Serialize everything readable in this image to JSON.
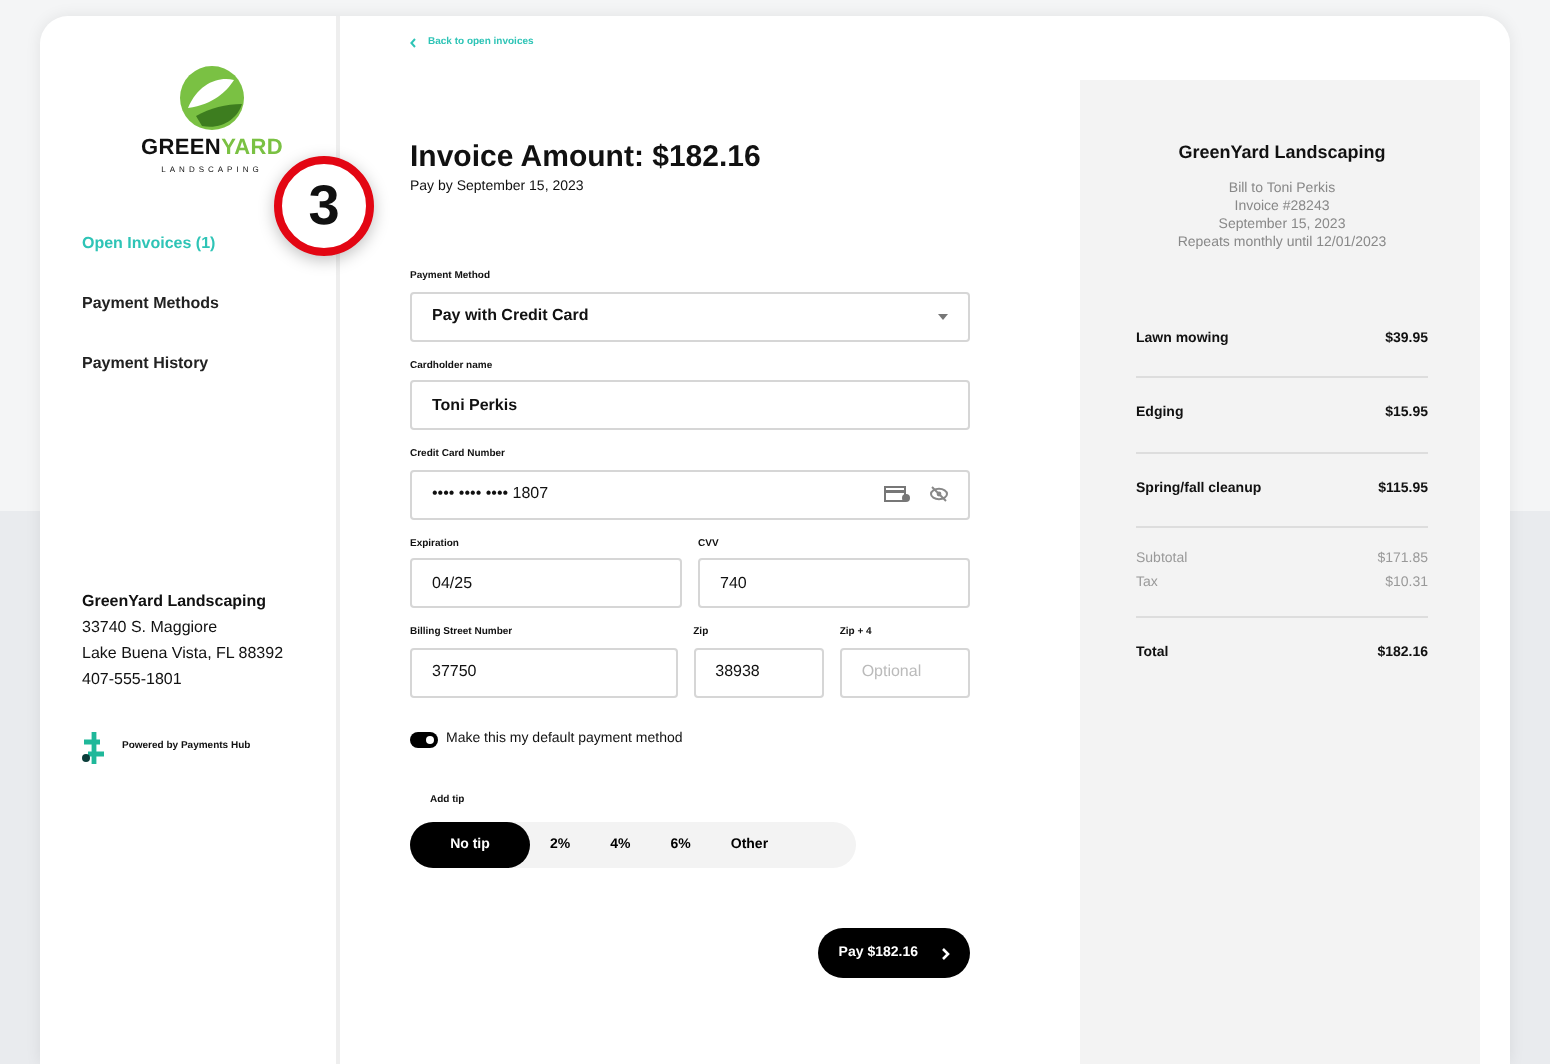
{
  "brand": {
    "name_dark": "GREEN",
    "name_accent": "YARD",
    "tagline": "LANDSCAPING"
  },
  "sidebar": {
    "items": [
      {
        "label": "Open Invoices (1)",
        "selected": true
      },
      {
        "label": "Payment Methods",
        "selected": false
      },
      {
        "label": "Payment History",
        "selected": false
      }
    ],
    "company": {
      "name": "GreenYard Landscaping",
      "lines": [
        "33740 S. Maggiore",
        "Lake Buena Vista, FL 88392",
        "407-555-1801"
      ]
    },
    "powered_by": "Powered by Payments Hub"
  },
  "step_badge": "3",
  "back_link": "Back to open invoices",
  "title": "Invoice Amount: $182.16",
  "subtitle": "Pay by September 15, 2023",
  "form": {
    "rows": [
      [
        {
          "kind": "select",
          "label": "Payment Method",
          "value": "Pay with Credit Card"
        }
      ],
      [
        {
          "kind": "text",
          "label": "Cardholder name",
          "value": "Toni Perkis"
        }
      ],
      [
        {
          "kind": "card",
          "label": "Credit Card Number",
          "value": "•••• •••• •••• 1807"
        }
      ],
      [
        {
          "kind": "text",
          "label": "Expiration",
          "value": "04/25"
        },
        {
          "kind": "text",
          "label": "CVV",
          "value": "740"
        }
      ],
      [
        {
          "kind": "text",
          "label": "Billing Street Number",
          "value": "37750"
        },
        {
          "kind": "text",
          "label": "Zip",
          "value": "38938"
        },
        {
          "kind": "text",
          "label": "Zip + 4",
          "placeholder": "Optional"
        }
      ]
    ]
  },
  "default_toggle": {
    "label": "Make this my default payment method",
    "on": true
  },
  "tip": {
    "label": "Add tip",
    "options": [
      {
        "label": "No tip",
        "selected": true
      },
      {
        "label": "2%",
        "selected": false
      },
      {
        "label": "4%",
        "selected": false
      },
      {
        "label": "6%",
        "selected": false
      },
      {
        "label": "Other",
        "selected": false
      }
    ]
  },
  "pay_button": "Pay $182.16",
  "summary": {
    "company": "GreenYard Landscaping",
    "info": [
      "Bill to Toni Perkis",
      "Invoice #28243",
      "September 15, 2023",
      "Repeats monthly until 12/01/2023"
    ],
    "items": [
      {
        "name": "Lawn mowing",
        "amount": "$39.95"
      },
      {
        "name": "Edging",
        "amount": "$15.95"
      },
      {
        "name": "Spring/fall cleanup",
        "amount": "$115.95"
      }
    ],
    "subtotals": [
      {
        "name": "Subtotal",
        "amount": "$171.85"
      },
      {
        "name": "Tax",
        "amount": "$10.31"
      }
    ],
    "total": {
      "name": "Total",
      "amount": "$182.16"
    }
  }
}
